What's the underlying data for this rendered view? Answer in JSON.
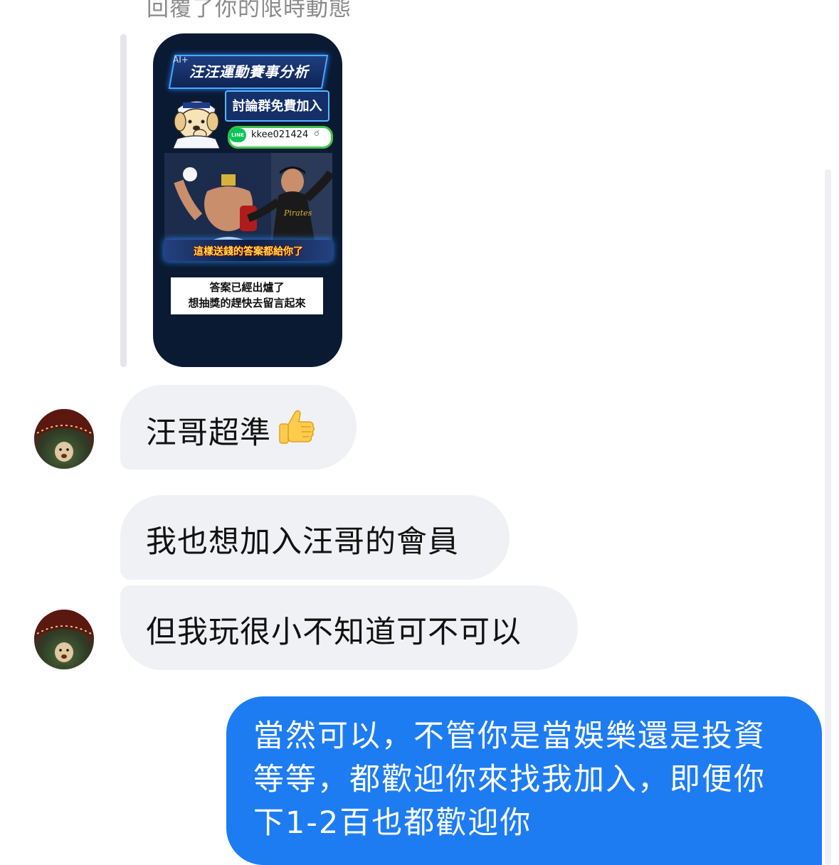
{
  "thread": {
    "reply_note": "回覆了你的限時動態"
  },
  "story": {
    "ai_tag": "AI+",
    "title": "汪汪運動賽事分析",
    "join_text": "討論群免費加入",
    "line_logo": "LINE",
    "line_id": "kkee021424",
    "caption": "這樣送錢的答案都給你了",
    "answer_line1": "答案已經出爐了",
    "answer_line2": "想抽獎的趕快去留言起來"
  },
  "messages": {
    "incoming": [
      {
        "text": "汪哥超準",
        "emoji": "thumbs-up"
      },
      {
        "text": "我也想加入汪哥的會員"
      },
      {
        "text": "但我玩很小不知道可不可以"
      }
    ],
    "outgoing": {
      "line1": "當然可以，不管你是當娛樂還是投資",
      "line2": "等等，都歡迎你來找我加入，即便你",
      "line3": "下1-2百也都歡迎你"
    }
  },
  "colors": {
    "outgoing_bubble": "#1d7cf2",
    "incoming_bubble": "#f0f1f4",
    "reply_note_text": "#8a8a8a",
    "story_background": "#0a1a33"
  }
}
